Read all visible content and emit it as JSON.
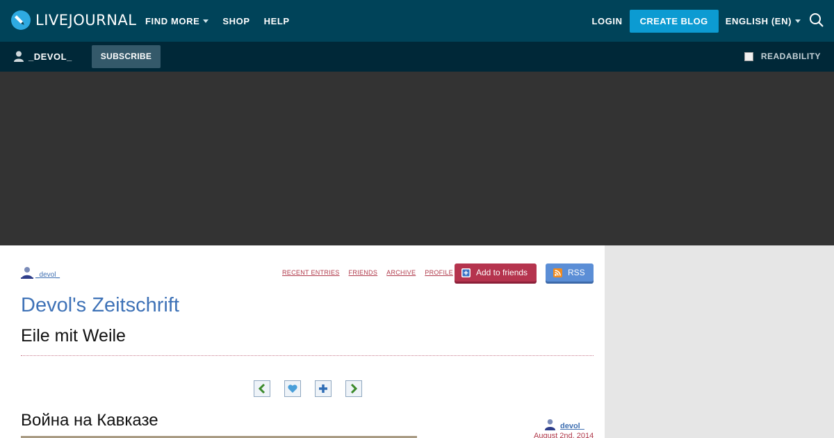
{
  "brand": {
    "name": "LIVEJOURNAL"
  },
  "topnav": {
    "find_more": "FIND MORE",
    "shop": "SHOP",
    "help": "HELP",
    "login": "LOGIN",
    "create_blog": "CREATE BLOG",
    "language": "ENGLISH (EN)"
  },
  "subbar": {
    "username": "_DEVOL_",
    "subscribe": "SUBSCRIBE",
    "readability": "READABILITY"
  },
  "journal": {
    "owner": "_devol_",
    "links": [
      "RECENT ENTRIES",
      "FRIENDS",
      "ARCHIVE",
      "PROFILE"
    ],
    "add_friends": "Add to friends",
    "rss": "RSS",
    "title": "Devol's Zeitschrift",
    "subtitle": "Eile mit Weile"
  },
  "post": {
    "title": "Война на Кавказе",
    "author": "devol_",
    "date": "August 2nd, 2014"
  },
  "colors": {
    "topbar": "#004359",
    "subbar": "#002838",
    "accent": "#0c9bd2",
    "journal_title": "#3e72b7",
    "link_red": "#b0394a"
  },
  "icons": [
    "livejournal-logo-icon",
    "search-icon",
    "user-icon",
    "prev-icon",
    "heart-icon",
    "plus-icon",
    "next-icon",
    "rss-icon"
  ]
}
